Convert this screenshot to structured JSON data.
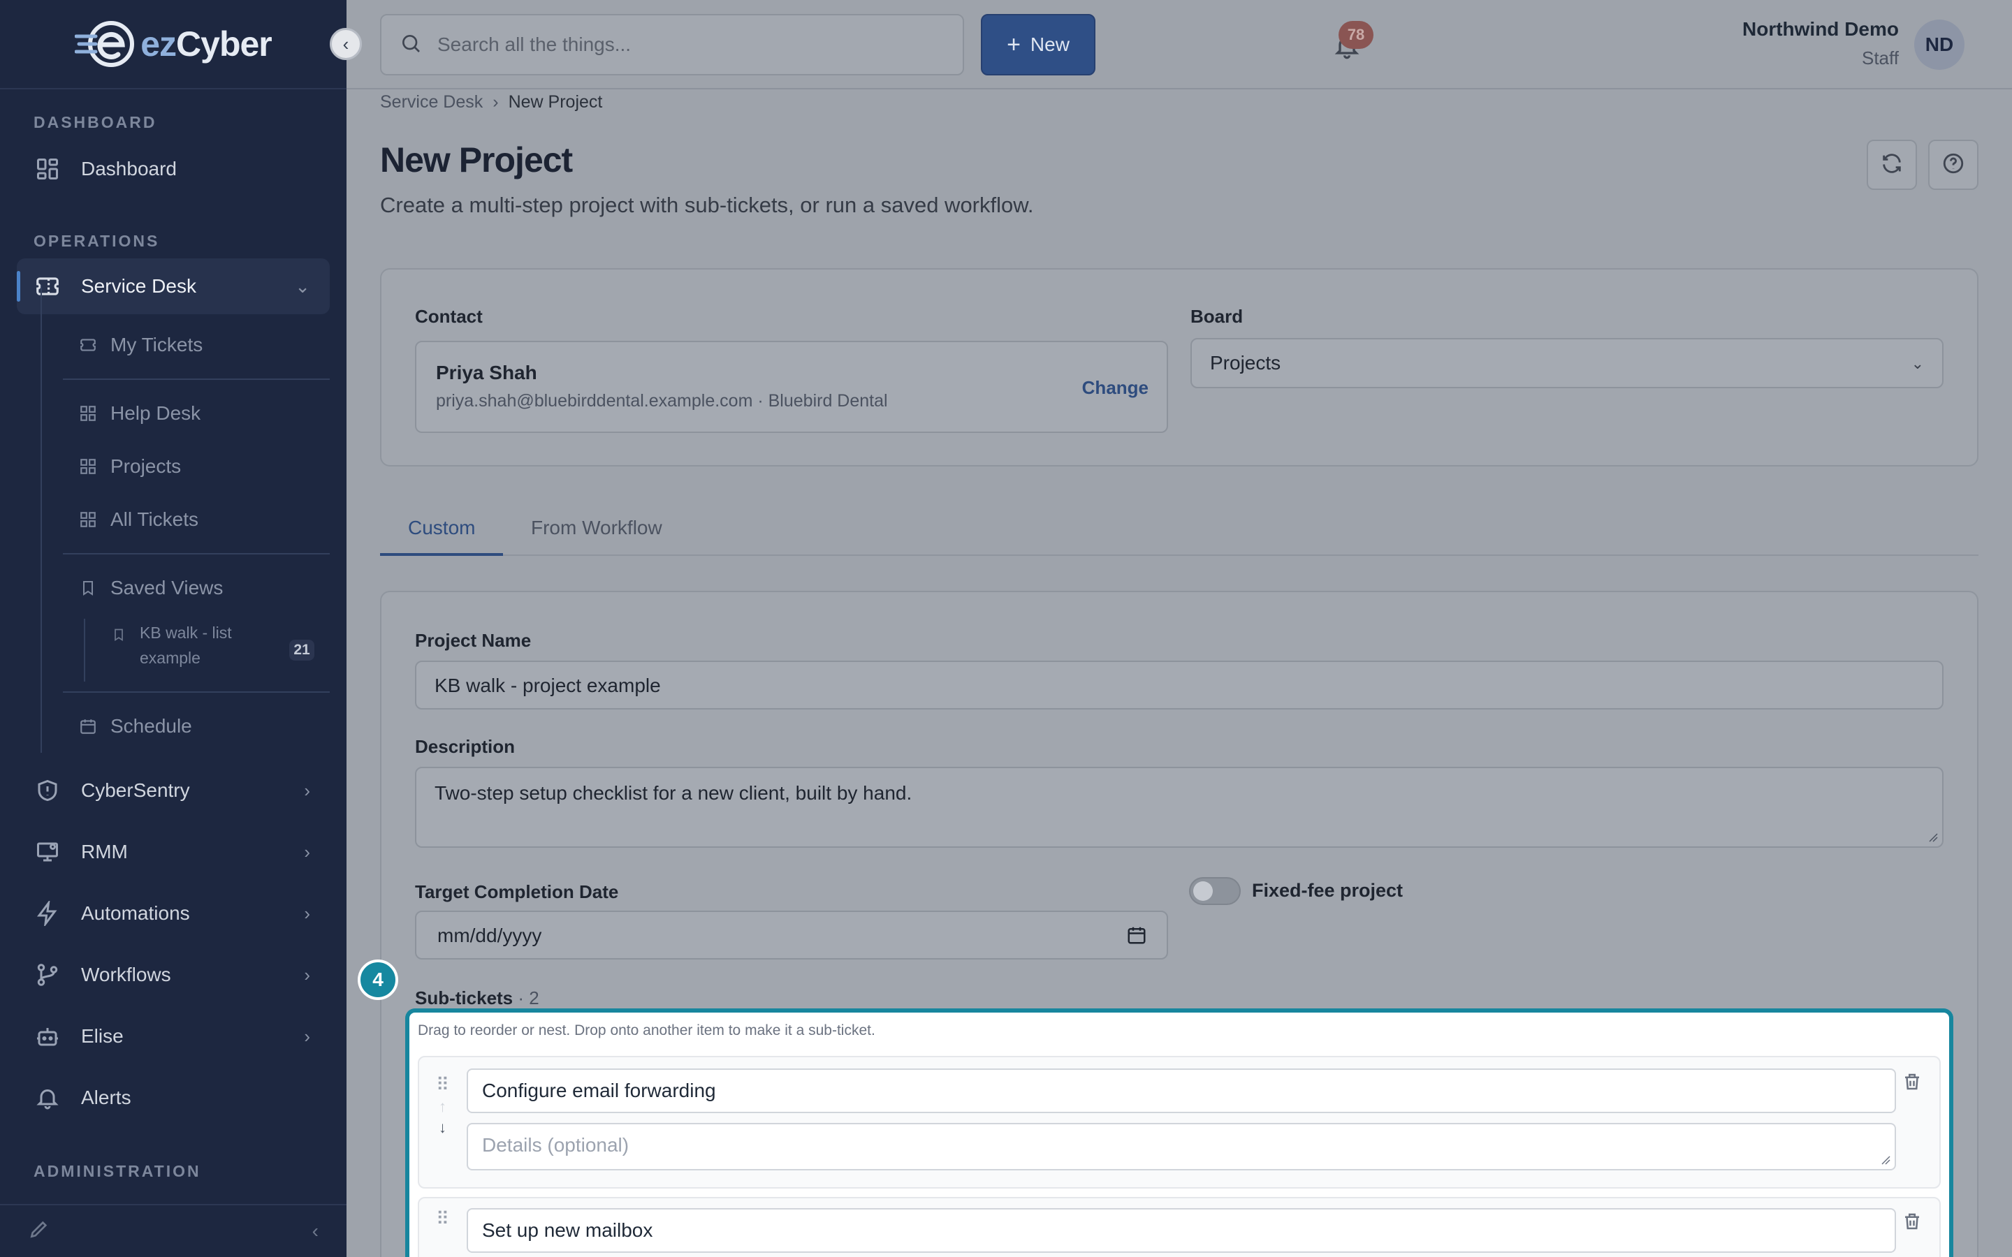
{
  "brand": {
    "name_prefix": "ez",
    "name_suffix": "Cyber"
  },
  "sidebar": {
    "sections": {
      "dashboard": "DASHBOARD",
      "operations": "OPERATIONS",
      "administration": "ADMINISTRATION"
    },
    "items": {
      "dashboard": "Dashboard",
      "service_desk": "Service Desk",
      "cybersentry": "CyberSentry",
      "rmm": "RMM",
      "automations": "Automations",
      "workflows": "Workflows",
      "elise": "Elise",
      "alerts": "Alerts"
    },
    "service_desk_children": {
      "my_tickets": "My Tickets",
      "help_desk": "Help Desk",
      "projects": "Projects",
      "all_tickets": "All Tickets",
      "saved_views": "Saved Views",
      "saved_view_line1": "KB walk - list",
      "saved_view_line2": "example",
      "saved_view_count": "21",
      "schedule": "Schedule"
    }
  },
  "topbar": {
    "search_placeholder": "Search all the things...",
    "new_label": "New",
    "notification_count": "78",
    "user_name": "Northwind Demo",
    "user_role": "Staff",
    "avatar_initials": "ND"
  },
  "breadcrumb": {
    "parent": "Service Desk",
    "separator": "›",
    "current": "New Project"
  },
  "page": {
    "title": "New Project",
    "subtitle": "Create a multi-step project with sub-tickets, or run a saved workflow."
  },
  "contact": {
    "label": "Contact",
    "name": "Priya Shah",
    "details": "priya.shah@bluebirddental.example.com · Bluebird Dental",
    "change": "Change"
  },
  "board": {
    "label": "Board",
    "value": "Projects"
  },
  "tabs": {
    "custom": "Custom",
    "from_workflow": "From Workflow"
  },
  "form": {
    "project_name_label": "Project Name",
    "project_name_value": "KB walk - project example",
    "description_label": "Description",
    "description_value": "Two-step setup checklist for a new client, built by hand.",
    "target_date_label": "Target Completion Date",
    "target_date_value": "mm/dd/yyyy",
    "fixed_fee_label": "Fixed-fee project",
    "fixed_fee_on": false
  },
  "subtickets": {
    "step_number": "4",
    "label": "Sub-tickets",
    "count": "· 2",
    "hint": "Drag to reorder or nest. Drop onto another item to make it a sub-ticket.",
    "items": [
      {
        "title": "Configure email forwarding",
        "details_placeholder": "Details (optional)"
      },
      {
        "title": "Set up new mailbox"
      }
    ]
  },
  "colors": {
    "sidebar_bg": "#1d2740",
    "accent": "#2f4f86",
    "spotlight": "#17869e"
  }
}
